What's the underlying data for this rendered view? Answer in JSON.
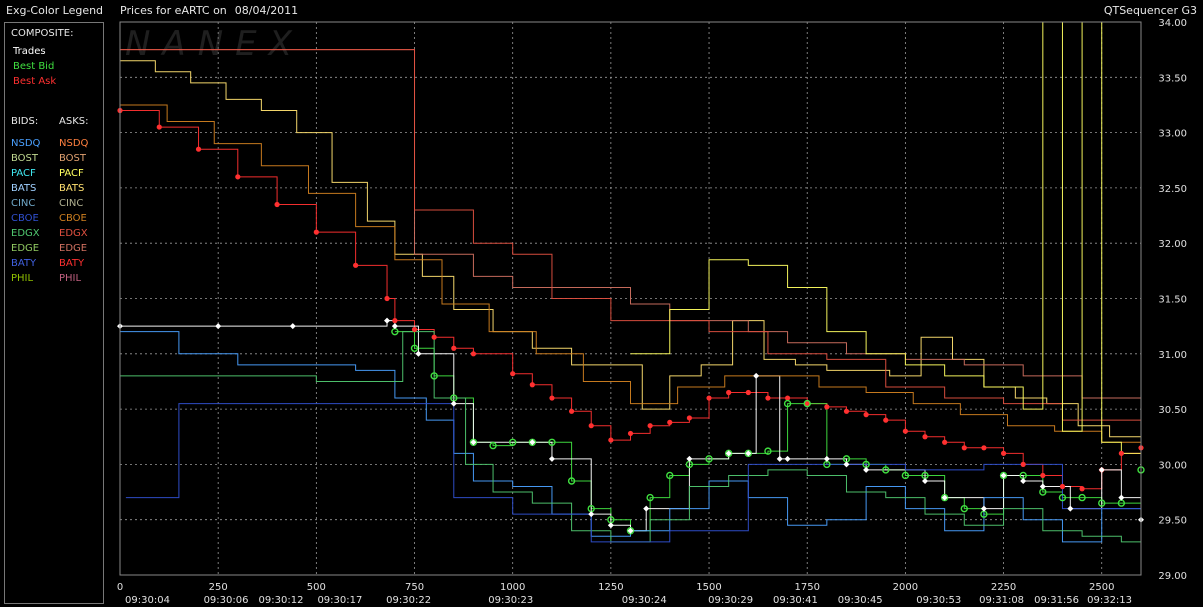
{
  "header": {
    "legend_title": "Exg-Color Legend",
    "chart_title": "Prices for  eARTC  on",
    "date": "08/04/2011",
    "app_name": "QTSequencer G3"
  },
  "watermark": "NANEX",
  "legend": {
    "composite_label": "COMPOSITE:",
    "composite": [
      {
        "label": "Trades",
        "color": "#ffffff"
      },
      {
        "label": "Best Bid",
        "color": "#40e040"
      },
      {
        "label": "Best Ask",
        "color": "#ff3030"
      }
    ],
    "bids_label": "BIDS:",
    "asks_label": "ASKS:",
    "bids": [
      {
        "label": "NSDQ",
        "color": "#4aa0ff"
      },
      {
        "label": "BOST",
        "color": "#c0d890"
      },
      {
        "label": "PACF",
        "color": "#40e8f0"
      },
      {
        "label": "BATS",
        "color": "#a0d0ff"
      },
      {
        "label": "CINC",
        "color": "#70a8c8"
      },
      {
        "label": "CBOE",
        "color": "#3050d0"
      },
      {
        "label": "EDGX",
        "color": "#50c870"
      },
      {
        "label": "EDGE",
        "color": "#90c860"
      },
      {
        "label": "BATY",
        "color": "#4060e0"
      },
      {
        "label": "PHIL",
        "color": "#90c000"
      }
    ],
    "asks": [
      {
        "label": "NSDQ",
        "color": "#ff8040"
      },
      {
        "label": "BOST",
        "color": "#e0a070"
      },
      {
        "label": "PACF",
        "color": "#ffff60"
      },
      {
        "label": "BATS",
        "color": "#ffe070"
      },
      {
        "label": "CINC",
        "color": "#b0b090"
      },
      {
        "label": "CBOE",
        "color": "#d08020"
      },
      {
        "label": "EDGX",
        "color": "#e05040"
      },
      {
        "label": "EDGE",
        "color": "#d07060"
      },
      {
        "label": "BATY",
        "color": "#ff3030"
      },
      {
        "label": "PHIL",
        "color": "#c06080"
      }
    ]
  },
  "chart_data": {
    "type": "line",
    "ylim": [
      29.0,
      34.0
    ],
    "y_ticks": [
      "29.00",
      "29.50",
      "30.00",
      "30.50",
      "31.00",
      "31.50",
      "32.00",
      "32.50",
      "33.00",
      "33.50",
      "34.00"
    ],
    "xlim": [
      0,
      2600
    ],
    "x_ticks": [
      {
        "seq": 0,
        "label": "0"
      },
      {
        "seq": 250,
        "label": "250"
      },
      {
        "seq": 500,
        "label": "500"
      },
      {
        "seq": 750,
        "label": "750"
      },
      {
        "seq": 1000,
        "label": "1000"
      },
      {
        "seq": 1250,
        "label": "1250"
      },
      {
        "seq": 1500,
        "label": "1500"
      },
      {
        "seq": 1750,
        "label": "1750"
      },
      {
        "seq": 2000,
        "label": "2000"
      },
      {
        "seq": 2250,
        "label": "2250"
      },
      {
        "seq": 2500,
        "label": "2500"
      }
    ],
    "time_labels": [
      {
        "seq": 70,
        "label": "09:30:04"
      },
      {
        "seq": 270,
        "label": "09:30:06"
      },
      {
        "seq": 410,
        "label": "09:30:12"
      },
      {
        "seq": 560,
        "label": "09:30:17"
      },
      {
        "seq": 735,
        "label": "09:30:22"
      },
      {
        "seq": 995,
        "label": "09:30:23"
      },
      {
        "seq": 1335,
        "label": "09:30:24"
      },
      {
        "seq": 1555,
        "label": "09:30:29"
      },
      {
        "seq": 1720,
        "label": "09:30:41"
      },
      {
        "seq": 1885,
        "label": "09:30:45"
      },
      {
        "seq": 2085,
        "label": "09:30:53"
      },
      {
        "seq": 2245,
        "label": "09:31:08"
      },
      {
        "seq": 2385,
        "label": "09:31:56"
      },
      {
        "seq": 2520,
        "label": "09:32:13"
      }
    ],
    "grid": true,
    "series": [
      {
        "name": "Best Ask",
        "color": "#ff3030",
        "marker": "dot",
        "x": [
          0,
          100,
          200,
          300,
          400,
          500,
          600,
          680,
          700,
          750,
          800,
          850,
          900,
          1000,
          1050,
          1100,
          1150,
          1200,
          1250,
          1300,
          1350,
          1400,
          1450,
          1500,
          1550,
          1600,
          1650,
          1700,
          1750,
          1800,
          1850,
          1900,
          1950,
          2000,
          2050,
          2100,
          2150,
          2200,
          2250,
          2300,
          2350,
          2400,
          2450,
          2500,
          2550,
          2600
        ],
        "y": [
          33.2,
          33.05,
          32.85,
          32.6,
          32.35,
          32.1,
          31.8,
          31.5,
          31.3,
          31.22,
          31.15,
          31.05,
          31.0,
          30.82,
          30.72,
          30.6,
          30.48,
          30.35,
          30.22,
          30.28,
          30.35,
          30.38,
          30.42,
          30.6,
          30.65,
          30.65,
          30.6,
          30.6,
          30.55,
          30.52,
          30.48,
          30.45,
          30.4,
          30.3,
          30.25,
          30.2,
          30.15,
          30.15,
          30.1,
          30.0,
          29.9,
          29.8,
          29.78,
          29.95,
          30.1,
          30.15
        ]
      },
      {
        "name": "Best Bid",
        "color": "#40e040",
        "marker": "ring",
        "x": [
          700,
          750,
          800,
          850,
          900,
          950,
          1000,
          1050,
          1100,
          1150,
          1200,
          1250,
          1300,
          1350,
          1400,
          1450,
          1500,
          1550,
          1600,
          1650,
          1700,
          1750,
          1800,
          1850,
          1900,
          1950,
          2000,
          2050,
          2100,
          2150,
          2200,
          2250,
          2300,
          2350,
          2400,
          2450,
          2500,
          2550,
          2600
        ],
        "y": [
          31.2,
          31.05,
          30.8,
          30.6,
          30.2,
          30.17,
          30.2,
          30.2,
          30.2,
          29.85,
          29.6,
          29.5,
          29.4,
          29.7,
          29.9,
          30.0,
          30.05,
          30.1,
          30.1,
          30.12,
          30.55,
          30.55,
          30.0,
          30.05,
          30.0,
          29.95,
          29.9,
          29.9,
          29.7,
          29.6,
          29.55,
          29.9,
          29.9,
          29.75,
          29.7,
          29.7,
          29.65,
          29.65,
          29.95
        ]
      },
      {
        "name": "Trades",
        "color": "#ffffff",
        "marker": "diamond",
        "x": [
          0,
          250,
          440,
          680,
          700,
          760,
          850,
          900,
          1050,
          1100,
          1200,
          1250,
          1300,
          1340,
          1450,
          1550,
          1600,
          1620,
          1680,
          1700,
          1800,
          1850,
          1900,
          2050,
          2100,
          2200,
          2250,
          2300,
          2350,
          2420,
          2500,
          2550,
          2600
        ],
        "y": [
          31.25,
          31.25,
          31.25,
          31.3,
          31.25,
          31.0,
          30.55,
          30.2,
          30.2,
          30.05,
          29.55,
          29.45,
          29.4,
          29.6,
          30.05,
          30.1,
          30.1,
          30.8,
          30.05,
          30.05,
          30.05,
          30.0,
          29.95,
          29.85,
          29.7,
          29.6,
          29.9,
          29.85,
          29.8,
          29.6,
          29.95,
          29.7,
          29.5
        ]
      },
      {
        "name": "NSDQ",
        "color": "#4aa0ff",
        "marker": "none",
        "x": [
          0,
          150,
          300,
          450,
          600,
          700,
          780,
          850,
          900,
          1000,
          1100,
          1200,
          1300,
          1400,
          1500,
          1600,
          1700,
          1800,
          1900,
          2000,
          2100,
          2200,
          2300,
          2400,
          2500,
          2600
        ],
        "y": [
          31.2,
          31.0,
          30.9,
          30.9,
          30.85,
          30.6,
          30.4,
          30.1,
          29.85,
          29.8,
          29.55,
          29.35,
          29.4,
          29.6,
          29.85,
          29.7,
          29.45,
          29.5,
          29.8,
          29.6,
          29.4,
          29.7,
          29.5,
          29.3,
          29.6,
          29.4
        ]
      },
      {
        "name": "EDGX",
        "color": "#50c870",
        "marker": "none",
        "x": [
          0,
          220,
          500,
          720,
          800,
          880,
          950,
          1050,
          1150,
          1250,
          1350,
          1450,
          1550,
          1650,
          1750,
          1850,
          1950,
          2050,
          2150,
          2250,
          2350,
          2450,
          2550,
          2600
        ],
        "y": [
          30.8,
          30.8,
          30.75,
          31.2,
          30.6,
          30.0,
          29.75,
          29.65,
          29.4,
          29.3,
          29.5,
          29.8,
          29.9,
          29.95,
          29.9,
          29.75,
          29.7,
          29.55,
          29.45,
          29.6,
          29.4,
          29.35,
          29.3,
          29.45
        ]
      },
      {
        "name": "CBOE",
        "color": "#3050d0",
        "marker": "none",
        "x": [
          15,
          150,
          150,
          400,
          700,
          850,
          1000,
          1200,
          1400,
          1600,
          1800,
          2000,
          2200,
          2400,
          2600
        ],
        "y": [
          29.7,
          29.7,
          30.55,
          30.55,
          30.55,
          29.7,
          29.55,
          29.3,
          29.4,
          30.0,
          30.0,
          29.95,
          30.0,
          29.6,
          29.9
        ]
      },
      {
        "name": "BATS",
        "color": "#ffe070",
        "marker": "none",
        "x": [
          0,
          90,
          180,
          270,
          360,
          450,
          540,
          630,
          700,
          770,
          850,
          950,
          1050,
          1150,
          1250,
          1330,
          1400,
          1480,
          1560,
          1640,
          1720,
          1800,
          1880,
          1960,
          2040,
          2120,
          2200,
          2280,
          2360,
          2440,
          2520,
          2600
        ],
        "y": [
          33.65,
          33.55,
          33.45,
          33.3,
          33.2,
          33.0,
          32.55,
          32.2,
          31.9,
          31.7,
          31.4,
          31.2,
          31.05,
          30.9,
          30.9,
          30.5,
          30.8,
          30.9,
          31.3,
          30.95,
          30.9,
          30.85,
          30.85,
          30.8,
          31.15,
          30.95,
          30.7,
          30.6,
          30.55,
          30.35,
          30.25,
          30.2
        ]
      },
      {
        "name": "CBOE ask",
        "color": "#d08020",
        "marker": "none",
        "x": [
          0,
          120,
          240,
          360,
          480,
          600,
          700,
          820,
          940,
          1060,
          1180,
          1300,
          1420,
          1540,
          1660,
          1780,
          1900,
          2020,
          2140,
          2260,
          2380,
          2500,
          2600
        ],
        "y": [
          33.25,
          33.1,
          32.9,
          32.7,
          32.45,
          32.15,
          31.85,
          31.45,
          31.2,
          31.0,
          30.75,
          30.55,
          30.7,
          30.8,
          30.8,
          30.7,
          30.65,
          30.55,
          30.45,
          30.35,
          30.3,
          30.2,
          30.15
        ]
      },
      {
        "name": "EDGE ask",
        "color": "#d07060",
        "marker": "none",
        "x": [
          0,
          150,
          300,
          450,
          600,
          700,
          750,
          900,
          1000,
          1150,
          1300,
          1400,
          1500,
          1600,
          1700,
          1850,
          2000,
          2150,
          2300,
          2450,
          2600
        ],
        "y": [
          33.75,
          33.75,
          33.75,
          33.75,
          33.75,
          33.75,
          31.9,
          31.7,
          31.6,
          31.6,
          31.45,
          31.3,
          31.3,
          31.2,
          31.1,
          31.0,
          30.95,
          30.9,
          30.8,
          30.6,
          30.55
        ]
      },
      {
        "name": "EDGX ask",
        "color": "#e05040",
        "marker": "none",
        "x": [
          0,
          400,
          700,
          750,
          900,
          1000,
          1100,
          1250,
          1350,
          1500,
          1650,
          1800,
          1950,
          2100,
          2250,
          2400,
          2600
        ],
        "y": [
          33.75,
          33.75,
          33.75,
          32.3,
          32.0,
          31.9,
          31.5,
          31.3,
          31.3,
          31.2,
          31.0,
          30.95,
          30.7,
          30.6,
          30.55,
          30.4,
          30.35
        ]
      },
      {
        "name": "PACF ask",
        "color": "#ffff60",
        "marker": "none",
        "x": [
          1300,
          1400,
          1500,
          1600,
          1700,
          1800,
          1900,
          2000,
          2100,
          2200,
          2300,
          2350,
          2400,
          2450,
          2500,
          2550,
          2600
        ],
        "y": [
          31.0,
          31.4,
          31.85,
          31.8,
          31.6,
          31.2,
          31.0,
          30.9,
          30.8,
          30.7,
          30.5,
          34.0,
          30.3,
          34.0,
          30.2,
          30.1,
          30.0
        ]
      }
    ]
  }
}
